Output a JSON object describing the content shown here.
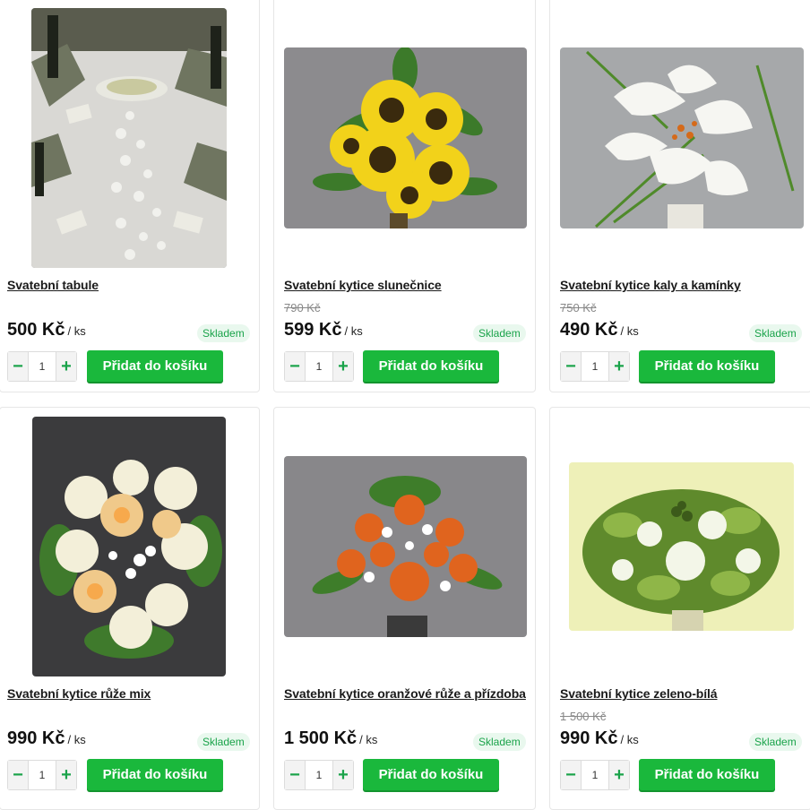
{
  "products": [
    {
      "title": "Svatební tabule",
      "old_price": "",
      "price": "500 Kč",
      "unit": "/ ks",
      "stock": "Skladem",
      "qty": "1",
      "add_label": "Přidat do košíku",
      "minus": "−",
      "plus": "+"
    },
    {
      "title": "Svatební kytice slunečnice",
      "old_price": "790 Kč",
      "price": "599 Kč",
      "unit": "/ ks",
      "stock": "Skladem",
      "qty": "1",
      "add_label": "Přidat do košíku",
      "minus": "−",
      "plus": "+"
    },
    {
      "title": "Svatební kytice kaly a kamínky",
      "old_price": "750 Kč",
      "price": "490 Kč",
      "unit": "/ ks",
      "stock": "Skladem",
      "qty": "1",
      "add_label": "Přidat do košíku",
      "minus": "−",
      "plus": "+"
    },
    {
      "title": "Svatební kytice růže mix",
      "old_price": "",
      "price": "990 Kč",
      "unit": "/ ks",
      "stock": "Skladem",
      "qty": "1",
      "add_label": "Přidat do košíku",
      "minus": "−",
      "plus": "+"
    },
    {
      "title": "Svatební kytice oranžové růže a přízdoba",
      "old_price": "",
      "price": "1 500 Kč",
      "unit": "/ ks",
      "stock": "Skladem",
      "qty": "1",
      "add_label": "Přidat do košíku",
      "minus": "−",
      "plus": "+"
    },
    {
      "title": "Svatební kytice zeleno-bílá",
      "old_price": "1 500 Kč",
      "price": "990 Kč",
      "unit": "/ ks",
      "stock": "Skladem",
      "qty": "1",
      "add_label": "Přidat do košíku",
      "minus": "−",
      "plus": "+"
    }
  ],
  "colors": {
    "accent": "#1ab83c",
    "stock_text": "#1aa34a",
    "stock_bg": "#e9f8ee"
  }
}
